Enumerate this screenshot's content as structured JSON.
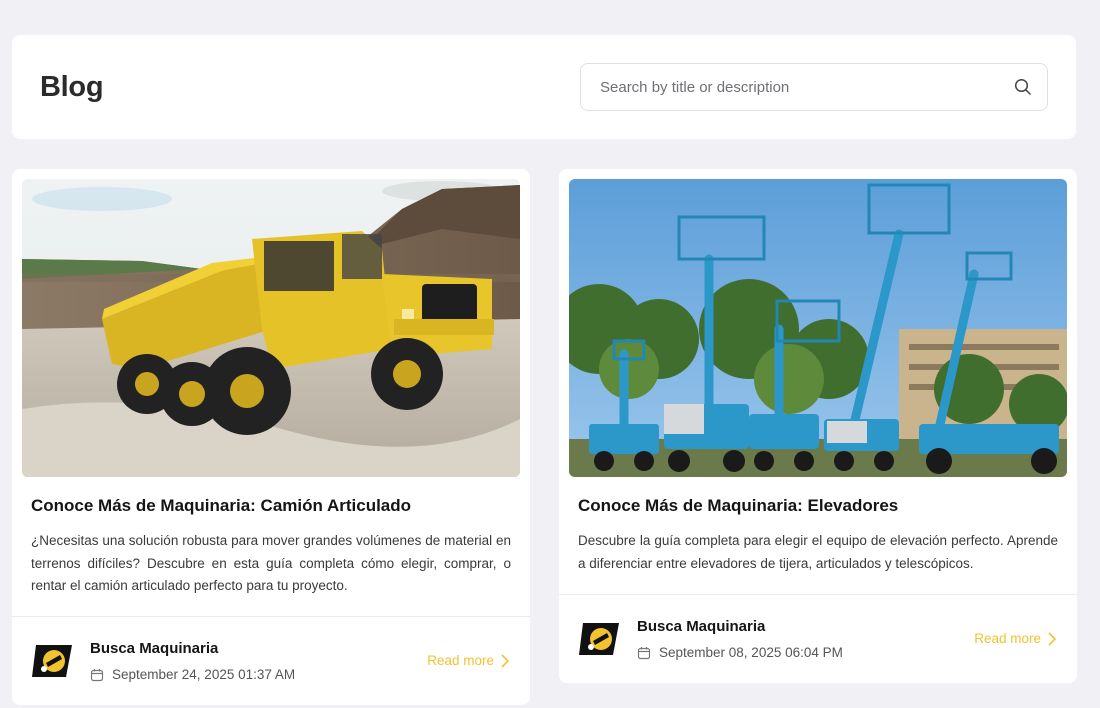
{
  "header": {
    "title": "Blog",
    "search": {
      "placeholder": "Search by title or description",
      "value": ""
    }
  },
  "posts": [
    {
      "title": "Conoce Más de Maquinaria: Camión Articulado",
      "description": "¿Necesitas una solución robusta para mover grandes volúmenes de material en terrenos difíciles? Descubre en esta guía completa cómo elegir, comprar, o rentar el camión articulado perfecto para tu proyecto.",
      "author": "Busca Maquinaria",
      "date": "September 24, 2025 01:37 AM",
      "read_more": "Read more",
      "image": "articulated-truck-photo"
    },
    {
      "title": "Conoce Más de Maquinaria: Elevadores",
      "description": "Descubre la guía completa para elegir el equipo de elevación perfecto. Aprende a diferenciar entre elevadores de tijera, articulados y telescópicos.",
      "author": "Busca Maquinaria",
      "date": "September 08, 2025 06:04 PM",
      "read_more": "Read more",
      "image": "aerial-lifts-photo"
    }
  ],
  "colors": {
    "accent": "#f2c230",
    "background": "#f1f0f4",
    "card": "#ffffff"
  }
}
